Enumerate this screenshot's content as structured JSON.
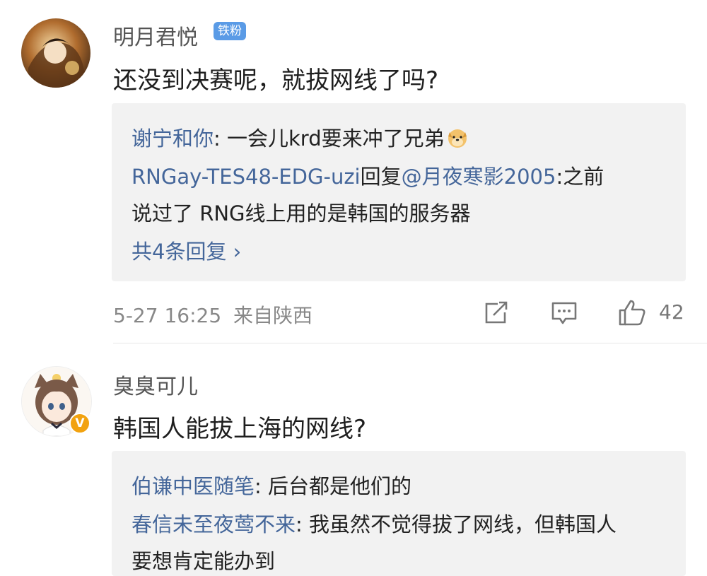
{
  "comments": [
    {
      "username": "明月君悦",
      "badge": "铁粉",
      "text": "还没到决赛呢，就拔网线了吗?",
      "replies": [
        {
          "name": "谢宁和你",
          "sep": ": ",
          "text": "一会儿krd要来冲了兄弟",
          "emoji": "doge-emoji"
        },
        {
          "name": "RNGay-TES48-EDG-uzi",
          "mid": "回复",
          "mention": "@月夜寒影2005",
          "sep": ":",
          "text": "之前",
          "cont": "说过了 RNG线上用的是韩国的服务器"
        }
      ],
      "more_replies": "共4条回复 ›",
      "timestamp": "5-27 16:25",
      "location": "来自陕西",
      "like_count": "42",
      "icons": {
        "share": "share-icon",
        "comment": "comment-icon",
        "like": "thumbs-up-icon"
      }
    },
    {
      "username": "臭臭可儿",
      "verified": "V",
      "text": "韩国人能拔上海的网线?",
      "replies": [
        {
          "name": "伯谦中医随笔",
          "sep": ": ",
          "text": "后台都是他们的"
        },
        {
          "name": "春信未至夜莺不来",
          "sep": ": ",
          "text": "我虽然不觉得拔了网线，但韩国人",
          "cont": "要想肯定能办到"
        }
      ]
    }
  ],
  "colors": {
    "link": "#44669a",
    "badge": "#5a9be6",
    "reply_bg": "#f2f2f2",
    "verified": "#f2a20f"
  }
}
